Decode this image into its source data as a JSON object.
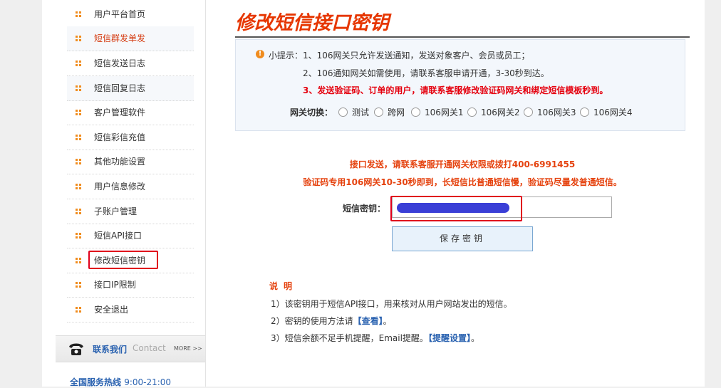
{
  "sidebar": {
    "items": [
      {
        "label": "用户平台首页"
      },
      {
        "label": "短信群发单发"
      },
      {
        "label": "短信发送日志"
      },
      {
        "label": "短信回复日志"
      },
      {
        "label": "客户管理软件"
      },
      {
        "label": "短信彩信充值"
      },
      {
        "label": "其他功能设置"
      },
      {
        "label": "用户信息修改"
      },
      {
        "label": "子账户管理"
      },
      {
        "label": "短信API接口"
      },
      {
        "label": "修改短信密钥"
      },
      {
        "label": "接口IP限制"
      },
      {
        "label": "安全退出"
      }
    ],
    "contact": {
      "title": "联系我们",
      "subtitle": "Contact",
      "more": "MORE >>"
    },
    "hotline": {
      "label": "全国服务热线",
      "hours": "9:00-21:00"
    }
  },
  "main": {
    "title": "修改短信接口密钥",
    "tips": {
      "line1": "小提示：1、106网关只允许发送通知，发送对象客户、会员或员工；",
      "line2": "2、106通知网关如需使用，请联系客服申请开通，3-30秒到达。",
      "line3": "3、发送验证码、订单的用户，请联系客服修改验证码网关和绑定短信模板秒到。",
      "gateway_label": "网关切换：",
      "gateways": [
        "测试",
        "跨网",
        "106网关1",
        "106网关2",
        "106网关3",
        "106网关4"
      ]
    },
    "notice1": "接口发送，请联系客服开通网关权限或拨打400-6991455",
    "notice2": "验证码专用106网关10-30秒即到，长短信比普通短信慢，验证码尽量发普通短信。",
    "key_label": "短信密钥：",
    "save_button": "保存密钥",
    "desc_title": "说明",
    "desc": {
      "line1": "1）该密钥用于短信API接口，用来核对从用户网站发出的短信。",
      "line2_prefix": "2）密钥的使用方法请",
      "line2_link": "【查看】",
      "line2_suffix": "。",
      "line3_prefix": "3）短信余额不足手机提醒，Email提醒。",
      "line3_link": "【提醒设置】",
      "line3_suffix": "。"
    }
  },
  "colors": {
    "accent": "#e63600",
    "link": "#2a62b0",
    "highlight": "#e0001b"
  }
}
